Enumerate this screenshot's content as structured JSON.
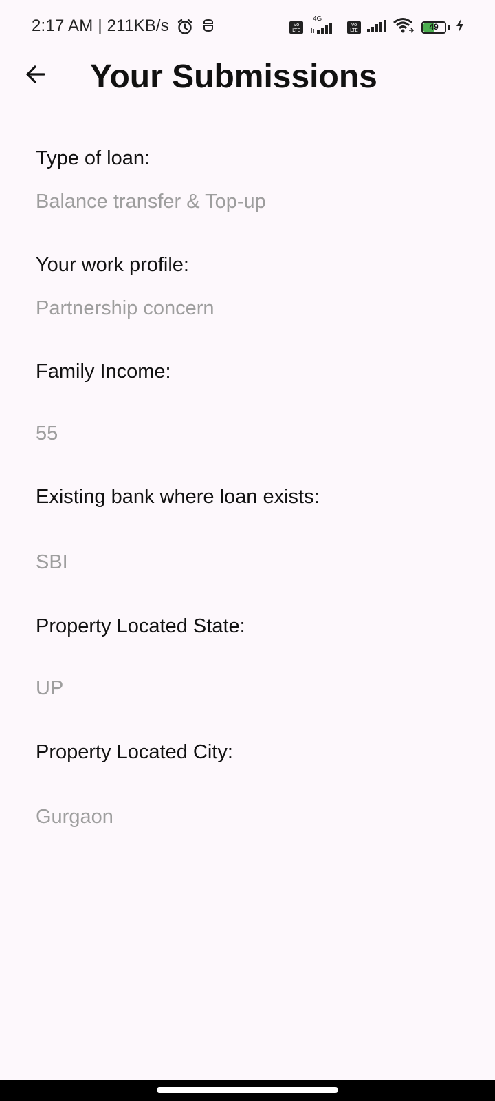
{
  "status_bar": {
    "time": "2:17 AM | 211KB/s",
    "network_label": "4G",
    "volte_label": "Vo LTE",
    "battery_level": "49"
  },
  "header": {
    "title": "Your Submissions",
    "back_icon": "arrow-back-icon"
  },
  "fields": [
    {
      "label": "Type of loan:",
      "value": "Balance transfer & Top-up"
    },
    {
      "label": "Your work profile:",
      "value": "Partnership concern"
    },
    {
      "label": "Family Income:",
      "value": "55"
    },
    {
      "label": "Existing bank where loan exists:",
      "value": "SBI"
    },
    {
      "label": "Property Located State:",
      "value": "UP"
    },
    {
      "label": "Property Located City:",
      "value": "Gurgaon"
    }
  ],
  "colors": {
    "background": "#fdf8fc",
    "label": "#111111",
    "value": "#9e9e9e",
    "battery": "#4caf50"
  }
}
